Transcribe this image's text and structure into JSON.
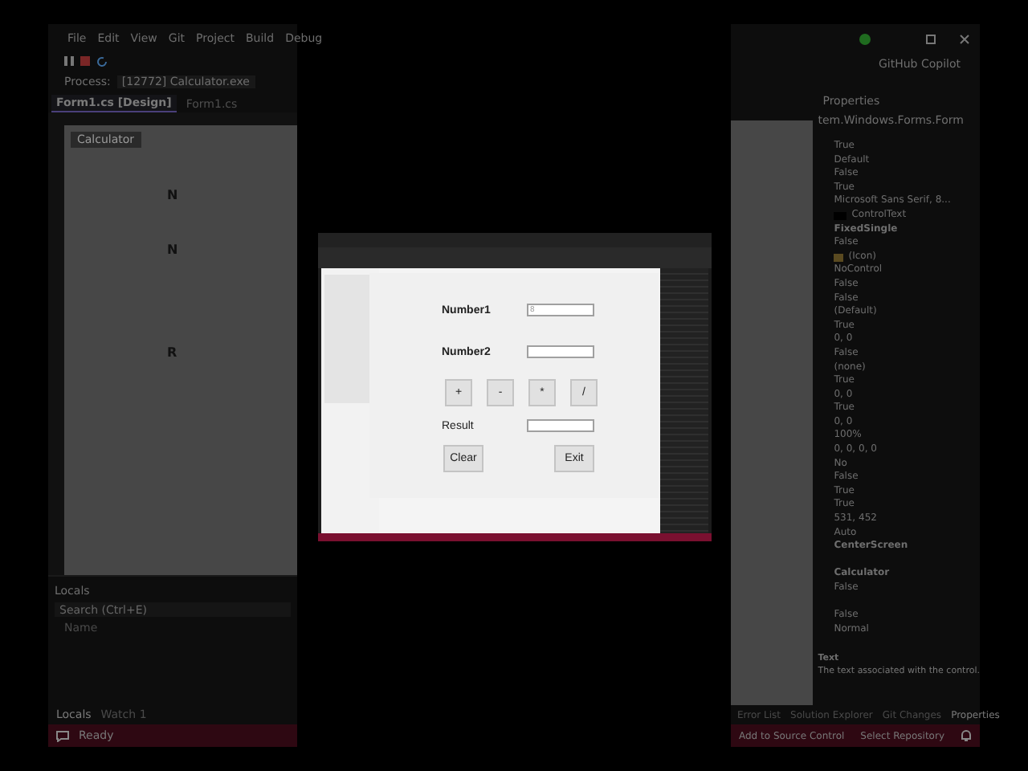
{
  "ide_left": {
    "menu": [
      "File",
      "Edit",
      "View",
      "Git",
      "Project",
      "Build",
      "Debug"
    ],
    "process": {
      "label": "Process:",
      "value": "[12772] Calculator.exe"
    },
    "tabs": [
      {
        "label": "Form1.cs [Design]",
        "selected": true
      },
      {
        "label": "Form1.cs",
        "selected": false
      }
    ],
    "form_title": "Calculator",
    "form_labels": [
      "N",
      "N",
      "R"
    ],
    "locals": {
      "title": "Locals",
      "placeholder": "Search (Ctrl+E)",
      "column": "Name"
    },
    "bottom_tabs": [
      {
        "label": "Locals",
        "selected": true
      },
      {
        "label": "Watch 1",
        "selected": false
      }
    ],
    "status": "Ready"
  },
  "ide_right": {
    "copilot": "GitHub Copilot",
    "properties_title": "Properties",
    "object": "tem.Windows.Forms.Form",
    "values": [
      {
        "kind": "value",
        "text": "True",
        "bold": false
      },
      {
        "kind": "value",
        "text": "Default",
        "bold": false
      },
      {
        "kind": "value",
        "text": "False",
        "bold": false
      },
      {
        "kind": "value",
        "text": "True",
        "bold": false
      },
      {
        "kind": "value",
        "text": "Microsoft Sans Serif, 8...",
        "bold": false
      },
      {
        "kind": "swatch",
        "text": "ControlText",
        "bold": false
      },
      {
        "kind": "value",
        "text": "FixedSingle",
        "bold": true
      },
      {
        "kind": "value",
        "text": "False",
        "bold": false
      },
      {
        "kind": "icon",
        "text": "(Icon)",
        "bold": false
      },
      {
        "kind": "value",
        "text": "NoControl",
        "bold": false
      },
      {
        "kind": "value",
        "text": "False",
        "bold": false
      },
      {
        "kind": "value",
        "text": "False",
        "bold": false
      },
      {
        "kind": "value",
        "text": "(Default)",
        "bold": false
      },
      {
        "kind": "value",
        "text": "True",
        "bold": false
      },
      {
        "kind": "value",
        "text": "0, 0",
        "bold": false
      },
      {
        "kind": "value",
        "text": "False",
        "bold": false
      },
      {
        "kind": "value",
        "text": "(none)",
        "bold": false
      },
      {
        "kind": "value",
        "text": "True",
        "bold": false
      },
      {
        "kind": "value",
        "text": "0, 0",
        "bold": false
      },
      {
        "kind": "value",
        "text": "True",
        "bold": false
      },
      {
        "kind": "value",
        "text": "0, 0",
        "bold": false
      },
      {
        "kind": "value",
        "text": "100%",
        "bold": false
      },
      {
        "kind": "value",
        "text": "0, 0, 0, 0",
        "bold": false
      },
      {
        "kind": "value",
        "text": "No",
        "bold": false
      },
      {
        "kind": "value",
        "text": "False",
        "bold": false
      },
      {
        "kind": "value",
        "text": "True",
        "bold": false
      },
      {
        "kind": "value",
        "text": "True",
        "bold": false
      },
      {
        "kind": "value",
        "text": "531, 452",
        "bold": false
      },
      {
        "kind": "value",
        "text": "Auto",
        "bold": false
      },
      {
        "kind": "value",
        "text": "CenterScreen",
        "bold": true
      },
      {
        "kind": "gap"
      },
      {
        "kind": "value",
        "text": "Calculator",
        "bold": true
      },
      {
        "kind": "value",
        "text": "False",
        "bold": false
      },
      {
        "kind": "gap"
      },
      {
        "kind": "value",
        "text": "False",
        "bold": false
      },
      {
        "kind": "value",
        "text": "Normal",
        "bold": false
      }
    ],
    "description": {
      "title": "Text",
      "text": "The text associated with the control."
    },
    "tabs": [
      {
        "label": "Error List",
        "selected": false
      },
      {
        "label": "Solution Explorer",
        "selected": false
      },
      {
        "label": "Git Changes",
        "selected": false
      },
      {
        "label": "Properties",
        "selected": true
      }
    ],
    "status_items": [
      "Add to Source Control",
      "Select Repository"
    ]
  },
  "calculator": {
    "fields": [
      {
        "label": "Number1",
        "value": "8"
      },
      {
        "label": "Number2"
      }
    ],
    "operators": [
      "+",
      "-",
      "*",
      "/"
    ],
    "result": {
      "label": "Result"
    },
    "buttons": [
      "Clear",
      "Exit"
    ]
  }
}
